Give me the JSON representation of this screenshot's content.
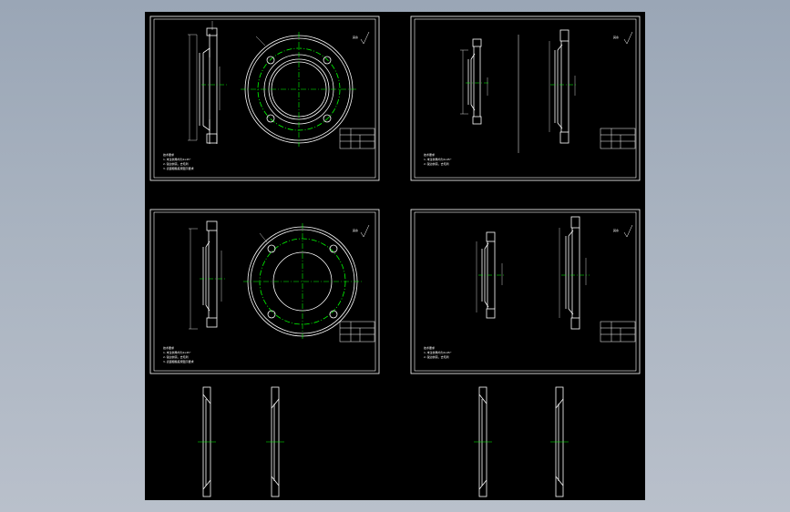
{
  "viewer": {
    "background_color": "#a4afbd",
    "canvas_color": "#000000"
  },
  "colors": {
    "outline": "#ffffff",
    "centerline": "#00ff00",
    "dimension": "#ffffff"
  },
  "sheets": [
    {
      "id": "sheet-1",
      "title_block": "",
      "roughness": "其余"
    },
    {
      "id": "sheet-2",
      "title_block": "",
      "roughness": "其余"
    },
    {
      "id": "sheet-3",
      "title_block": "",
      "roughness": "其余"
    },
    {
      "id": "sheet-4",
      "title_block": "",
      "roughness": "其余"
    }
  ],
  "notes_heading": "技术要求",
  "notes_lines": [
    "1.未注倒角均为1x45°",
    "2.锐边倒钝，去毛刺",
    "3.表面粗糙度按图示要求"
  ]
}
